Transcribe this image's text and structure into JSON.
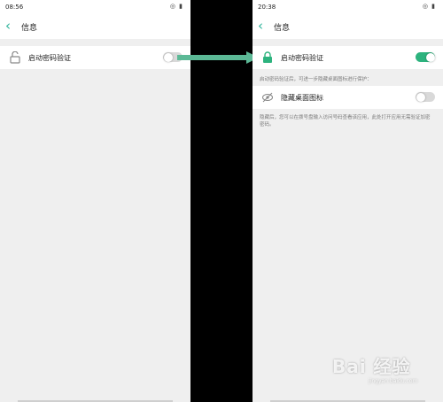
{
  "left": {
    "status_time": "08:56",
    "header_title": "信息",
    "row_label": "启动密码验证",
    "toggle_state": "off"
  },
  "right": {
    "status_time": "20:38",
    "header_title": "信息",
    "row_label": "启动密码验证",
    "toggle_state": "on",
    "note_top": "启动密码验证后，可进一步隐藏桌面图标进行保护：",
    "hide_icon_label": "隐藏桌面图标",
    "hide_toggle_state": "off",
    "note_bottom": "隐藏后，您可以在拨号盘输入访问号码查看该应用，此处打开应用无需验证加密密码。"
  },
  "watermark": {
    "brand": "Bai 经验",
    "domain": "jingyan.baidu.com"
  },
  "colors": {
    "accent": "#2db39a",
    "toggle_on": "#2db37e",
    "arrow": "#5cb996"
  }
}
